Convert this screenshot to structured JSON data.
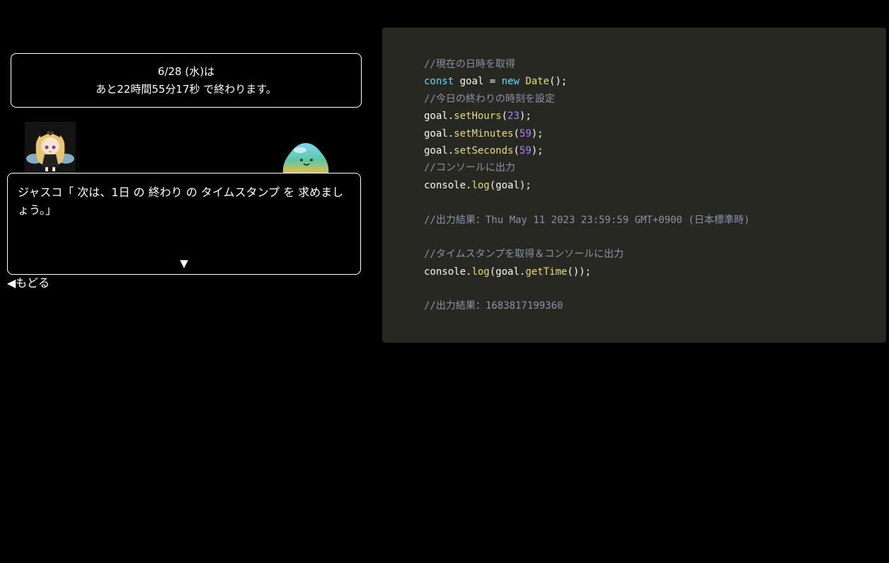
{
  "countdown": {
    "date_label": "6/28 (水)は",
    "remaining_text": "あと22時間55分17秒 で終わります。"
  },
  "characters": {
    "speaker_icon": "fairy-girl-avatar",
    "listener_icon": "slime-avatar"
  },
  "dialog": {
    "text": "ジャスコ「 次は、1日 の 終わり の タイムスタンプ を 求めましょう。」",
    "next_indicator": "▼"
  },
  "nav": {
    "back_label": "◀もどる"
  },
  "code": {
    "lines": [
      [
        "//現在の日時を取得"
      ],
      [
        "const",
        " goal = ",
        "new",
        " ",
        "Date",
        "();"
      ],
      [
        "//今日の終わりの時刻を設定"
      ],
      [
        "goal.",
        "setHours",
        "(",
        "23",
        ");"
      ],
      [
        "goal.",
        "setMinutes",
        "(",
        "59",
        ");"
      ],
      [
        "goal.",
        "setSeconds",
        "(",
        "59",
        ");"
      ],
      [
        "//コンソールに出力"
      ],
      [
        "console.",
        "log",
        "(goal);"
      ],
      [
        ""
      ],
      [
        "//出力結果：Thu May 11 2023 23:59:59 GMT+0900 (日本標準時)"
      ],
      [
        ""
      ],
      [
        "//タイムスタンプを取得＆コンソールに出力"
      ],
      [
        "console.",
        "log",
        "(goal.",
        "getTime",
        "());"
      ],
      [
        ""
      ],
      [
        "//出力結果：1683817199360"
      ]
    ]
  },
  "colors": {
    "background": "#000000",
    "code_bg": "#272822",
    "comment": "#8a93a6",
    "keyword": "#66d9ef",
    "function": "#e6db74",
    "number": "#ae81ff"
  }
}
